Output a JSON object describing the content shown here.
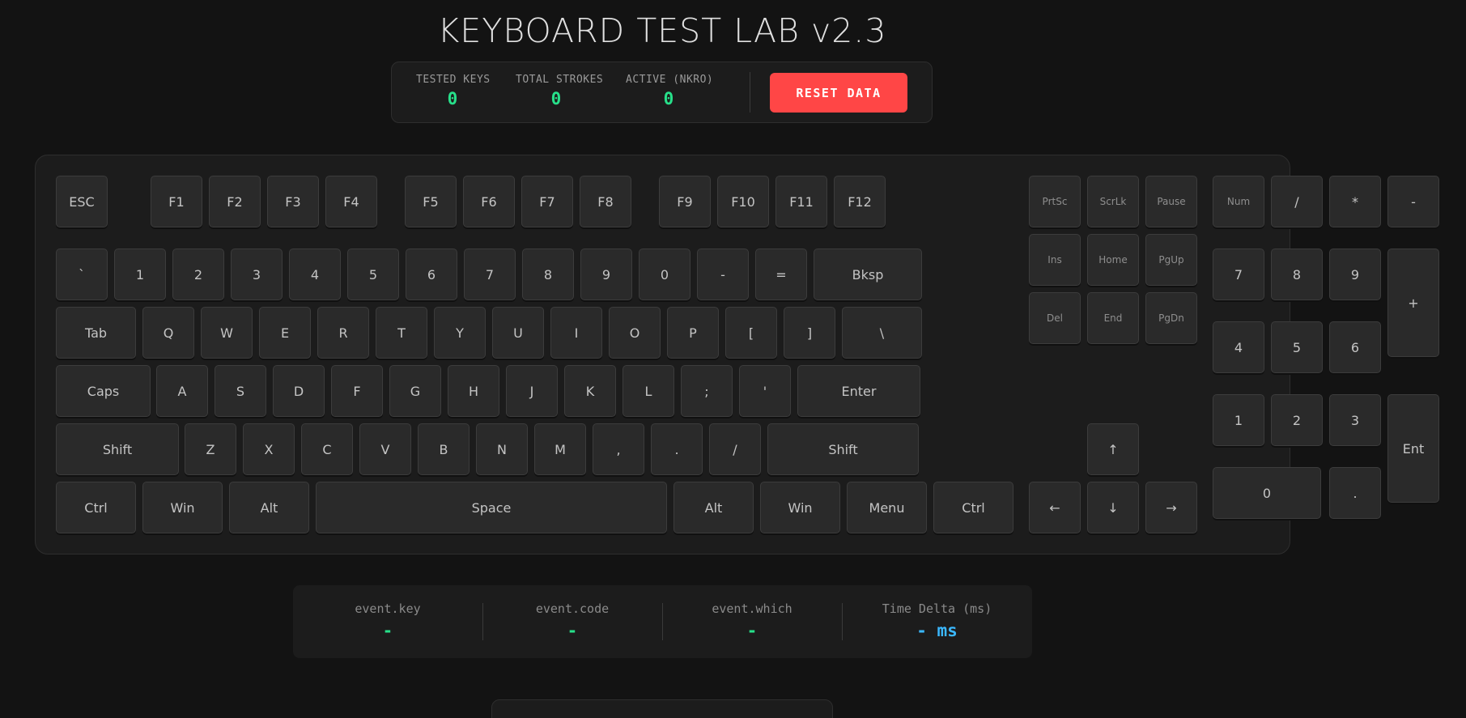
{
  "header": {
    "title": "KEYBOARD TEST LAB v2.3"
  },
  "stats": {
    "tested_keys_label": "TESTED KEYS",
    "tested_keys_value": "0",
    "total_strokes_label": "TOTAL STROKES",
    "total_strokes_value": "0",
    "active_label": "ACTIVE (NKRO)",
    "active_value": "0",
    "reset_label": "RESET DATA"
  },
  "keyboard": {
    "fn_row": {
      "esc": "ESC",
      "f1": "F1",
      "f2": "F2",
      "f3": "F3",
      "f4": "F4",
      "f5": "F5",
      "f6": "F6",
      "f7": "F7",
      "f8": "F8",
      "f9": "F9",
      "f10": "F10",
      "f11": "F11",
      "f12": "F12"
    },
    "number_row": {
      "backtick": "`",
      "k1": "1",
      "k2": "2",
      "k3": "3",
      "k4": "4",
      "k5": "5",
      "k6": "6",
      "k7": "7",
      "k8": "8",
      "k9": "9",
      "k0": "0",
      "minus": "-",
      "equal": "=",
      "backspace": "Bksp"
    },
    "qwerty_row": {
      "tab": "Tab",
      "q": "Q",
      "w": "W",
      "e": "E",
      "r": "R",
      "t": "T",
      "y": "Y",
      "u": "U",
      "i": "I",
      "o": "O",
      "p": "P",
      "lbracket": "[",
      "rbracket": "]",
      "backslash": "\\"
    },
    "home_row": {
      "caps": "Caps",
      "a": "A",
      "s": "S",
      "d": "D",
      "f": "F",
      "g": "G",
      "h": "H",
      "j": "J",
      "k": "K",
      "l": "L",
      "semicolon": ";",
      "quote": "'",
      "enter": "Enter"
    },
    "shift_row": {
      "lshift": "Shift",
      "z": "Z",
      "x": "X",
      "c": "C",
      "v": "V",
      "b": "B",
      "n": "N",
      "m": "M",
      "comma": ",",
      "period": ".",
      "slash": "/",
      "rshift": "Shift"
    },
    "bottom_row": {
      "lctrl": "Ctrl",
      "lwin": "Win",
      "lalt": "Alt",
      "space": "Space",
      "ralt": "Alt",
      "rwin": "Win",
      "menu": "Menu",
      "rctrl": "Ctrl"
    },
    "nav_cluster": {
      "prtsc": "PrtSc",
      "scrlk": "ScrLk",
      "pause": "Pause",
      "ins": "Ins",
      "home": "Home",
      "pgup": "PgUp",
      "del": "Del",
      "end": "End",
      "pgdn": "PgDn"
    },
    "arrows": {
      "up": "↑",
      "left": "←",
      "down": "↓",
      "right": "→"
    },
    "numpad": {
      "num": "Num",
      "div": "/",
      "mul": "*",
      "sub": "-",
      "n7": "7",
      "n8": "8",
      "n9": "9",
      "add": "+",
      "n4": "4",
      "n5": "5",
      "n6": "6",
      "n1": "1",
      "n2": "2",
      "n3": "3",
      "ent": "Ent",
      "n0": "0",
      "dot": "."
    }
  },
  "event_info": {
    "key_label": "event.key",
    "key_value": "-",
    "code_label": "event.code",
    "code_value": "-",
    "which_label": "event.which",
    "which_value": "-",
    "delta_label": "Time Delta (ms)",
    "delta_value": "- ms"
  }
}
